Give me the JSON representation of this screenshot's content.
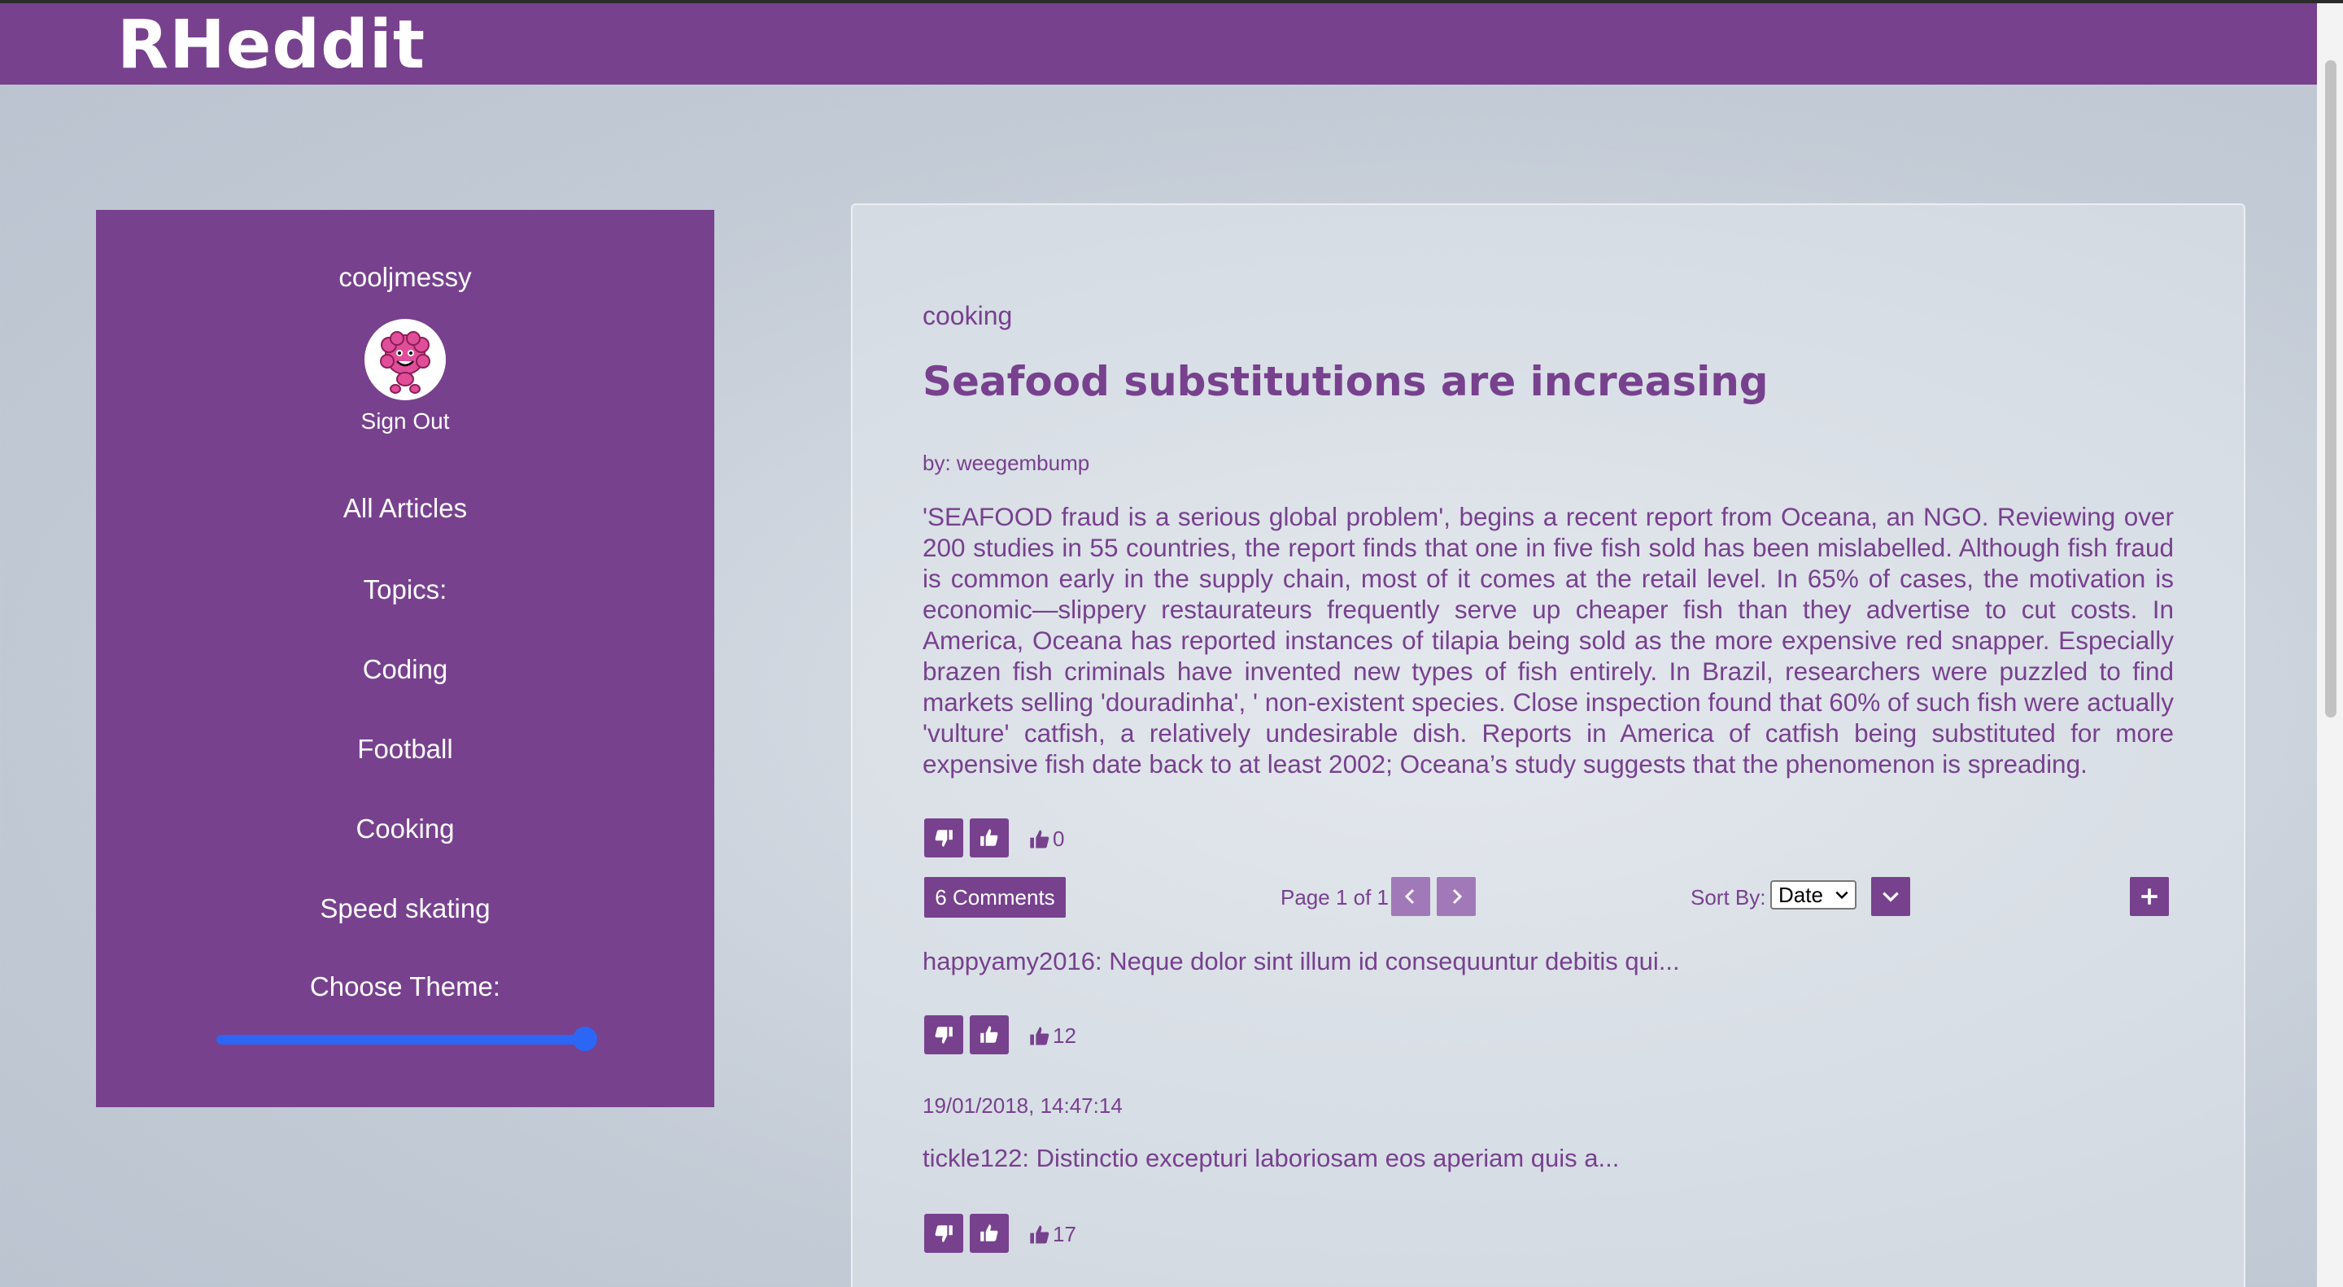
{
  "app": {
    "logo": "RHeddit"
  },
  "colors": {
    "brand": "#77418e",
    "accent_blue": "#2b66f5"
  },
  "sidebar": {
    "username": "cooljmessy",
    "sign_out": "Sign Out",
    "all_articles": "All Articles",
    "topics_label": "Topics:",
    "topics": [
      "Coding",
      "Football",
      "Cooking",
      "Speed skating"
    ],
    "theme_label": "Choose Theme:",
    "theme_slider_value": 1.0
  },
  "article": {
    "topic": "cooking",
    "title": "Seafood substitutions are increasing",
    "author": "by: weegembump",
    "body": "'SEAFOOD fraud is a serious global problem', begins a recent report from Oceana, an NGO. Reviewing over 200 studies in 55 countries, the report finds that one in five fish sold has been mislabelled. Although fish fraud is common early in the supply chain, most of it comes at the retail level. In 65% of cases, the motivation is economic—slippery restaurateurs frequently serve up cheaper fish than they advertise to cut costs. In America, Oceana has reported instances of tilapia being sold as the more expensive red snapper. Especially brazen fish criminals have invented new types of fish entirely. In Brazil, researchers were puzzled to find markets selling 'douradinha', ' non-existent species. Close inspection found that 60% of such fish were actually 'vulture' catfish, a relatively undesirable dish. Reports in America of catfish being substituted for more expensive fish date back to at least 2002; Oceana’s study suggests that the phenomenon is spreading.",
    "votes": "0"
  },
  "comments_bar": {
    "comments_button": "6 Comments",
    "page_info": "Page 1 of 1",
    "sort_label": "Sort By:",
    "sort_value": "Date"
  },
  "comments": [
    {
      "text": "happyamy2016: Neque dolor sint illum id consequuntur debitis qui...",
      "votes": "12"
    },
    {
      "date": "19/01/2018, 14:47:14",
      "text": "tickle122: Distinctio excepturi laboriosam eos aperiam quis a...",
      "votes": "17"
    }
  ],
  "icons": {
    "vote_down": "thumbs-down-icon",
    "vote_up": "thumbs-up-icon",
    "prev": "chevron-left-icon",
    "next": "chevron-right-icon",
    "sort_dir": "chevron-down-icon",
    "add": "plus-icon"
  }
}
